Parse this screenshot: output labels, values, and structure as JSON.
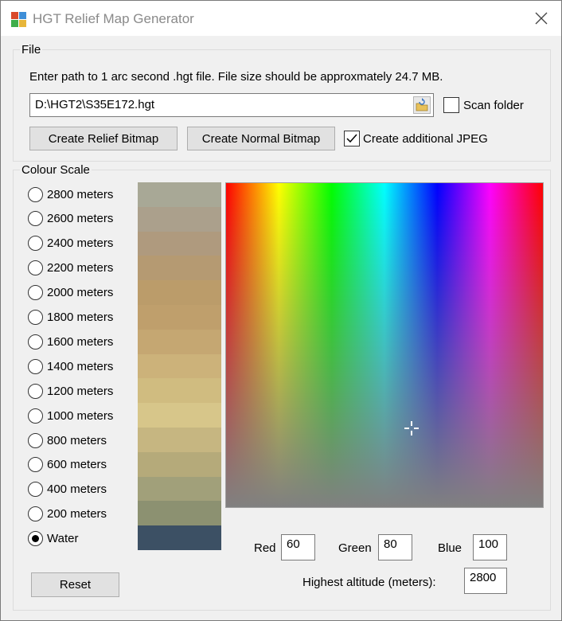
{
  "window": {
    "title": "HGT Relief Map Generator"
  },
  "file_group": {
    "label": "File",
    "instruction": "Enter path to 1 arc second .hgt file. File size should be approxmately 24.7 MB.",
    "path_value": "D:\\HGT2\\S35E172.hgt",
    "scan_folder_label": "Scan folder",
    "scan_folder_checked": false,
    "create_relief_label": "Create Relief Bitmap",
    "create_normal_label": "Create Normal Bitmap",
    "additional_jpeg_label": "Create additional JPEG",
    "additional_jpeg_checked": true
  },
  "colour_group": {
    "label": "Colour Scale",
    "levels": [
      {
        "label": "2800 meters",
        "color": "#a8a896",
        "selected": false
      },
      {
        "label": "2600 meters",
        "color": "#aba08c",
        "selected": false
      },
      {
        "label": "2400 meters",
        "color": "#af9a7e",
        "selected": false
      },
      {
        "label": "2200 meters",
        "color": "#b59a72",
        "selected": false
      },
      {
        "label": "2000 meters",
        "color": "#bb9c6a",
        "selected": false
      },
      {
        "label": "1800 meters",
        "color": "#bf9f6c",
        "selected": false
      },
      {
        "label": "1600 meters",
        "color": "#c5a772",
        "selected": false
      },
      {
        "label": "1400 meters",
        "color": "#ccb27a",
        "selected": false
      },
      {
        "label": "1200 meters",
        "color": "#d0bc80",
        "selected": false
      },
      {
        "label": "1000 meters",
        "color": "#d7c68a",
        "selected": false
      },
      {
        "label": "800 meters",
        "color": "#c6b681",
        "selected": false
      },
      {
        "label": "600 meters",
        "color": "#b5aa7a",
        "selected": false
      },
      {
        "label": "400 meters",
        "color": "#a1a07a",
        "selected": false
      },
      {
        "label": "200 meters",
        "color": "#8c9171",
        "selected": false
      },
      {
        "label": "Water",
        "color": "#3c5064",
        "selected": true
      }
    ],
    "reset_label": "Reset",
    "red_label": "Red",
    "red_value": "60",
    "green_label": "Green",
    "green_value": "80",
    "blue_label": "Blue",
    "blue_value": "100",
    "highest_label": "Highest altitude (meters):",
    "highest_value": "2800"
  }
}
